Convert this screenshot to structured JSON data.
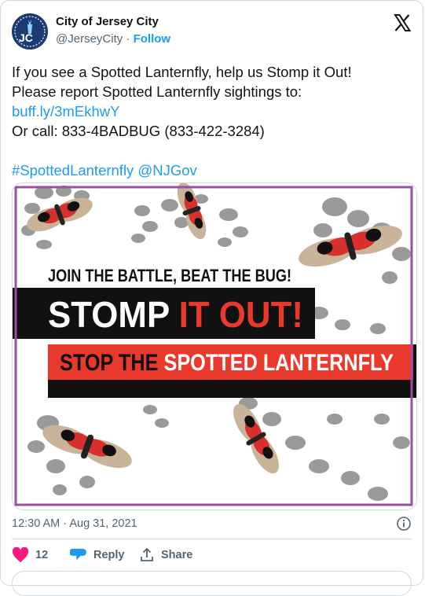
{
  "tweet": {
    "author_name": "City of Jersey City",
    "handle": "@JerseyCity",
    "separator": "·",
    "follow_label": "Follow",
    "lines": [
      "If you see a Spotted Lanternfly, help us Stomp it Out!",
      "Please report Spotted Lanternfly sightings to:",
      "buff.ly/3mEkhwY",
      "Or call: 833-4BADBUG (833-422-3284)",
      "#SpottedLanternfly @NJGov"
    ],
    "timestamp": "12:30 AM · Aug 31, 2021"
  },
  "poster": {
    "line1": "JOIN THE BATTLE, BEAT THE BUG!",
    "stomp_white": "STOMP ",
    "stomp_red": "IT OUT!",
    "stop_black": "STOP THE ",
    "stop_white": "SPOTTED LANTERNFLY"
  },
  "actions": {
    "like_count": "12",
    "reply_label": "Reply",
    "share_label": "Share"
  },
  "colors": {
    "link": "#1d9bf0",
    "heart": "#f91880",
    "poster_red": "#e8392c",
    "poster_border": "#9b4fa6"
  }
}
